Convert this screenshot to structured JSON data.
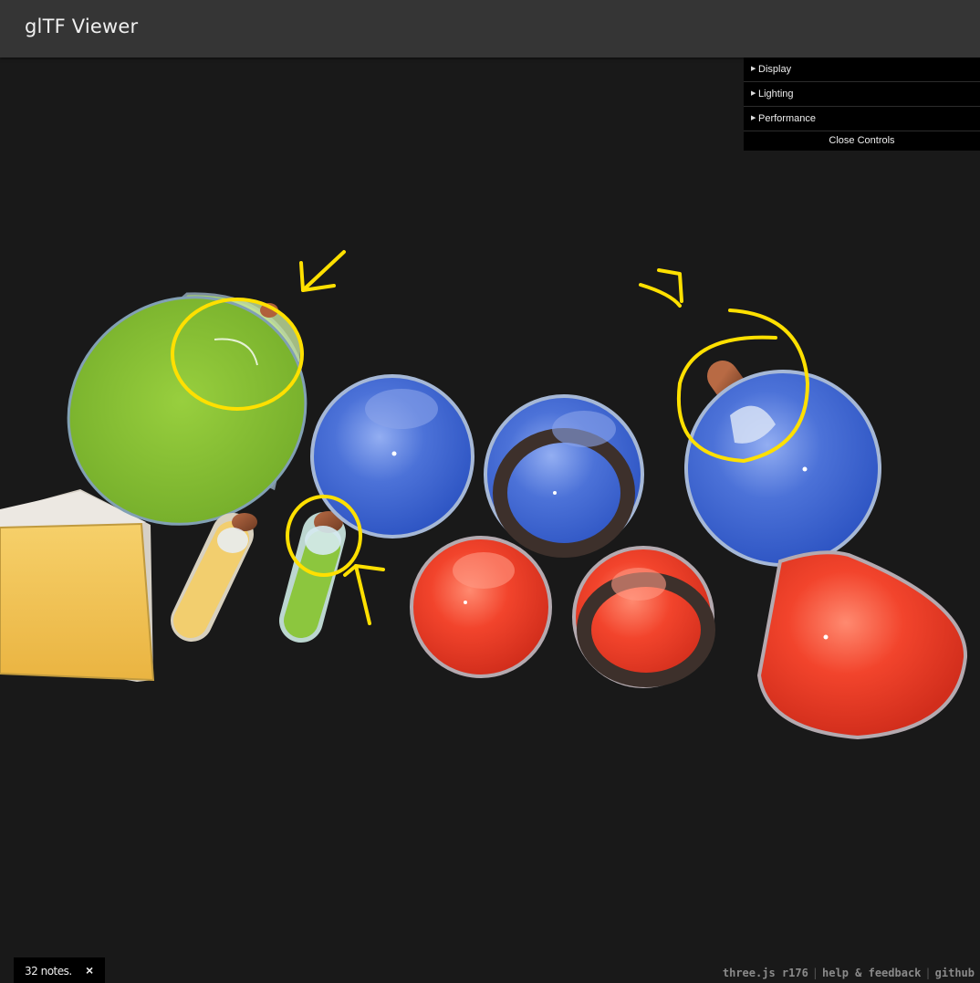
{
  "header": {
    "title": "glTF Viewer"
  },
  "controls": {
    "folders": [
      {
        "label": "Display"
      },
      {
        "label": "Lighting"
      },
      {
        "label": "Performance"
      }
    ],
    "close_label": "Close Controls"
  },
  "notes": {
    "label": "32 notes.",
    "close_glyph": "×"
  },
  "footer": {
    "version": "three.js r176",
    "help": "help & feedback",
    "github": "github",
    "separator": "|"
  },
  "scene": {
    "background_color": "#191919",
    "annotation_color": "#ffe000",
    "objects": [
      {
        "shape": "yellow-box",
        "color": "#f2c45a"
      },
      {
        "shape": "green-cylinder-flask",
        "color": "#8dc43a"
      },
      {
        "shape": "yellow-test-tube",
        "color": "#f3cf72"
      },
      {
        "shape": "green-test-tube",
        "color": "#8cc63e"
      },
      {
        "shape": "blue-sphere-flask",
        "color": "#4f78db"
      },
      {
        "shape": "blue-sphere-flask-banded",
        "color": "#4f78db"
      },
      {
        "shape": "blue-round-flask-large",
        "color": "#4f78db"
      },
      {
        "shape": "red-sphere-flask",
        "color": "#f2442c"
      },
      {
        "shape": "red-sphere-flask-banded",
        "color": "#f2442c"
      },
      {
        "shape": "red-cone-flask",
        "color": "#ef4a32"
      }
    ]
  }
}
